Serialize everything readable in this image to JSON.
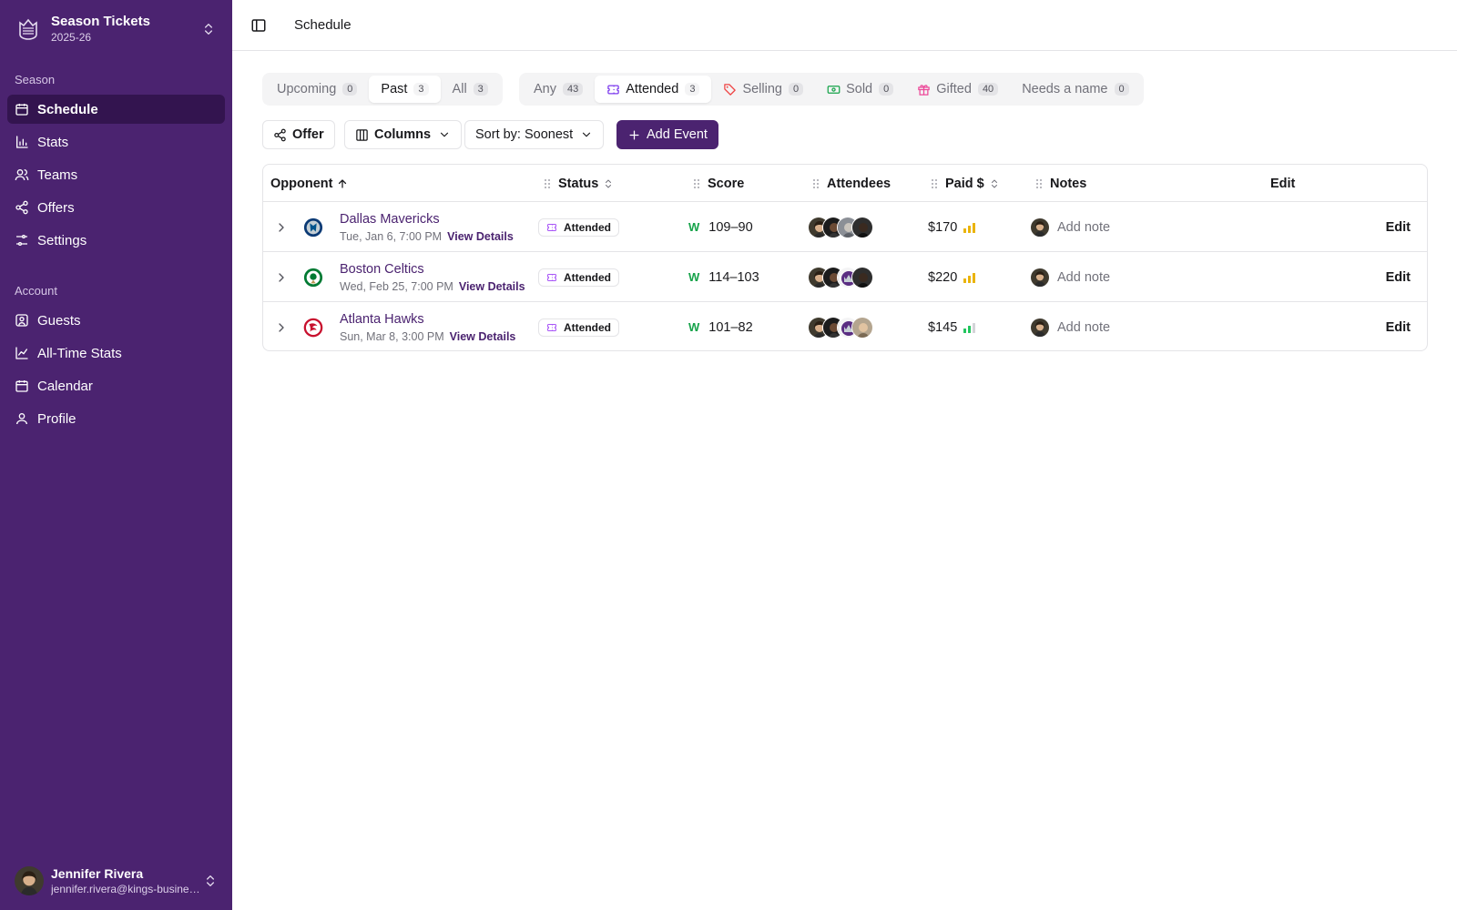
{
  "brand": {
    "title": "Season Tickets",
    "season": "2025-26"
  },
  "sidebar": {
    "season_label": "Season",
    "season_items": [
      {
        "label": "Schedule",
        "icon": "calendar-icon",
        "active": true
      },
      {
        "label": "Stats",
        "icon": "bar-chart-icon"
      },
      {
        "label": "Teams",
        "icon": "users-icon"
      },
      {
        "label": "Offers",
        "icon": "share-icon"
      },
      {
        "label": "Settings",
        "icon": "sliders-icon"
      }
    ],
    "account_label": "Account",
    "account_items": [
      {
        "label": "Guests",
        "icon": "contact-icon"
      },
      {
        "label": "All-Time Stats",
        "icon": "line-chart-icon"
      },
      {
        "label": "Calendar",
        "icon": "calendar-icon"
      },
      {
        "label": "Profile",
        "icon": "user-icon"
      }
    ],
    "user": {
      "name": "Jennifer Rivera",
      "email": "jennifer.rivera@kings-business.com"
    }
  },
  "header": {
    "title": "Schedule"
  },
  "time_filters": [
    {
      "label": "Upcoming",
      "count": "0"
    },
    {
      "label": "Past",
      "count": "3",
      "active": true
    },
    {
      "label": "All",
      "count": "3"
    }
  ],
  "status_filters": [
    {
      "label": "Any",
      "count": "43",
      "icon": ""
    },
    {
      "label": "Attended",
      "count": "3",
      "icon": "ticket-icon",
      "active": true
    },
    {
      "label": "Selling",
      "count": "0",
      "icon": "tag-icon"
    },
    {
      "label": "Sold",
      "count": "0",
      "icon": "cash-icon"
    },
    {
      "label": "Gifted",
      "count": "40",
      "icon": "gift-icon"
    },
    {
      "label": "Needs a name",
      "count": "0",
      "icon": ""
    }
  ],
  "toolbar": {
    "offer": "Offer",
    "columns": "Columns",
    "sort": "Sort by: Soonest",
    "add": "Add Event"
  },
  "columns": {
    "opponent": "Opponent",
    "status": "Status",
    "score": "Score",
    "attendees": "Attendees",
    "paid": "Paid $",
    "notes": "Notes",
    "edit": "Edit"
  },
  "rows": [
    {
      "opponent": "Dallas Mavericks",
      "date": "Tue, Jan 6, 7:00 PM",
      "view": "View Details",
      "status": "Attended",
      "result": "W",
      "score": "109–90",
      "paid": "$170",
      "price_level": 3,
      "level_color": "#eab308",
      "note": "Add note",
      "edit": "Edit",
      "logo": "mavericks-logo"
    },
    {
      "opponent": "Boston Celtics",
      "date": "Wed, Feb 25, 7:00 PM",
      "view": "View Details",
      "status": "Attended",
      "result": "W",
      "score": "114–103",
      "paid": "$220",
      "price_level": 3,
      "level_color": "#eab308",
      "note": "Add note",
      "edit": "Edit",
      "logo": "celtics-logo"
    },
    {
      "opponent": "Atlanta Hawks",
      "date": "Sun, Mar 8, 3:00 PM",
      "view": "View Details",
      "status": "Attended",
      "result": "W",
      "score": "101–82",
      "paid": "$145",
      "price_level": 2,
      "level_color": "#22c55e",
      "note": "Add note",
      "edit": "Edit",
      "logo": "hawks-logo"
    }
  ]
}
